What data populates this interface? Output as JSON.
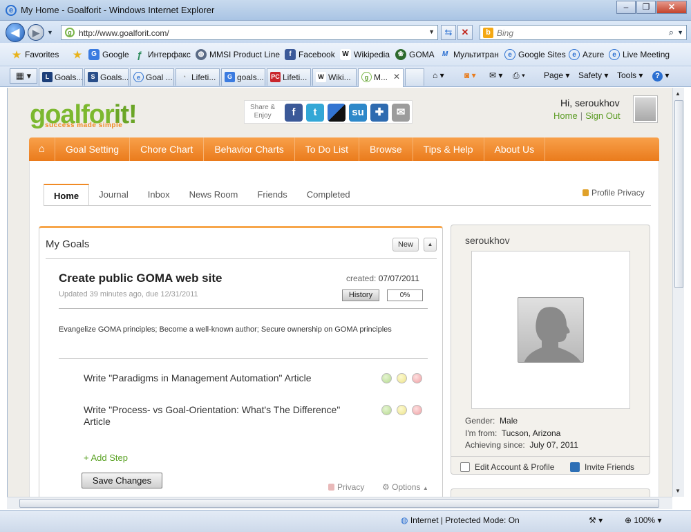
{
  "window": {
    "title": "My Home - Goalforit - Windows Internet Explorer"
  },
  "address": {
    "url": "http://www.goalforit.com/",
    "search_placeholder": "Bing"
  },
  "favorites": [
    {
      "label": "Favorites"
    },
    {
      "label": "Google"
    },
    {
      "label": "Интерфакс"
    },
    {
      "label": "MMSI Product Line"
    },
    {
      "label": "Facebook"
    },
    {
      "label": "Wikipedia"
    },
    {
      "label": "GOMA"
    },
    {
      "label": "Мультитран"
    },
    {
      "label": "Google Sites"
    },
    {
      "label": "Azure"
    },
    {
      "label": "Live Meeting"
    }
  ],
  "browser_tabs": [
    {
      "label": "Goals..."
    },
    {
      "label": "Goals..."
    },
    {
      "label": "Goal ..."
    },
    {
      "label": "Lifeti..."
    },
    {
      "label": "goals..."
    },
    {
      "label": "Lifeti..."
    },
    {
      "label": "Wiki..."
    },
    {
      "label": "M..."
    }
  ],
  "commands": {
    "page": "Page",
    "safety": "Safety",
    "tools": "Tools"
  },
  "site": {
    "logo_main": "goalfor",
    "logo_it": "it!",
    "tagline": "success made simple",
    "share_label_1": "Share &",
    "share_label_2": "Enjoy",
    "greeting": "Hi, seroukhov",
    "home_link": "Home",
    "signout_link": "Sign Out"
  },
  "main_nav": [
    "Goal Setting",
    "Chore Chart",
    "Behavior Charts",
    "To Do List",
    "Browse",
    "Tips & Help",
    "About Us"
  ],
  "sub_tabs": [
    "Home",
    "Journal",
    "Inbox",
    "News Room",
    "Friends",
    "Completed"
  ],
  "profile_privacy": "Profile Privacy",
  "goals_panel": {
    "header": "My Goals",
    "new_label": "New",
    "goal": {
      "title": "Create public GOMA web site",
      "meta": "Updated 39 minutes ago, due 12/31/2011",
      "created_label": "created:",
      "created_date": "07/07/2011",
      "history_label": "History",
      "progress": "0%",
      "description": "Evangelize GOMA principles; Become a well-known author; Secure ownership on GOMA principles",
      "steps": [
        {
          "text": "Write \"Paradigms in Management Automation\" Article"
        },
        {
          "text": "Write \"Process- vs Goal-Orientation: What's The Difference\" Article"
        }
      ],
      "add_step": "+ Add Step",
      "save_label": "Save Changes",
      "privacy_label": "Privacy",
      "options_label": "Options"
    }
  },
  "profile": {
    "username": "seroukhov",
    "gender_label": "Gender:",
    "gender": "Male",
    "from_label": "I'm from:",
    "from": "Tucson, Arizona",
    "since_label": "Achieving since:",
    "since": "July 07, 2011",
    "edit_label": "Edit Account & Profile",
    "invite_label": "Invite Friends"
  },
  "status": {
    "zone": "Internet | Protected Mode: On",
    "zoom": "100%"
  },
  "colors": {
    "accent_orange": "#ea7b1c",
    "brand_green": "#7cb82f",
    "link_green": "#5b9c24"
  }
}
